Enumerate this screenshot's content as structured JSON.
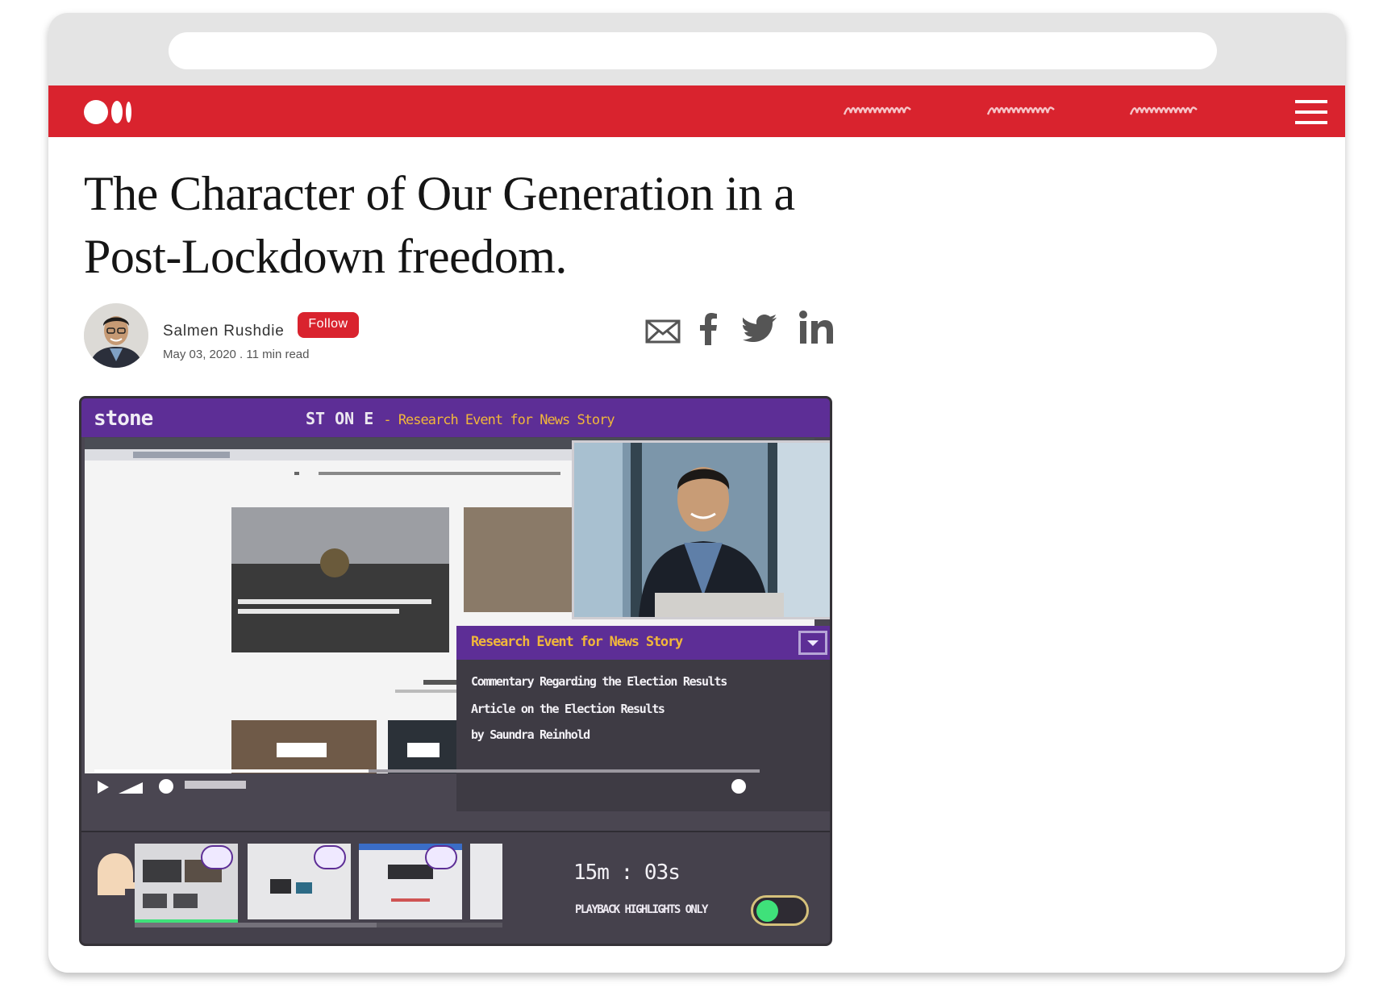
{
  "article": {
    "title": "The Character of Our Generation in a Post-Lockdown freedom.",
    "author": "Salmen Rushdie",
    "follow_label": "Follow",
    "meta": "May 03, 2020 . 11 min read"
  },
  "share": [
    "mail-icon",
    "facebook-icon",
    "twitter-icon",
    "linkedin-icon"
  ],
  "colors": {
    "brand_red": "#d9232e",
    "stone_purple": "#5d2e96",
    "stone_gold": "#f1b73a",
    "toggle_green": "#3fe17a"
  },
  "stone": {
    "logo": "stone",
    "header_title": "ST ON E",
    "header_subtitle": "- Research Event for News Story",
    "popup_title": "Research Event for News Story",
    "popup_lines": [
      "Commentary Regarding the Election Results",
      "Article on the Election Results",
      "by Saundra Reinhold"
    ],
    "timer": "15m : 03s",
    "playback_label": "PLAYBACK HIGHLIGHTS ONLY",
    "playback_highlights_only": true
  }
}
